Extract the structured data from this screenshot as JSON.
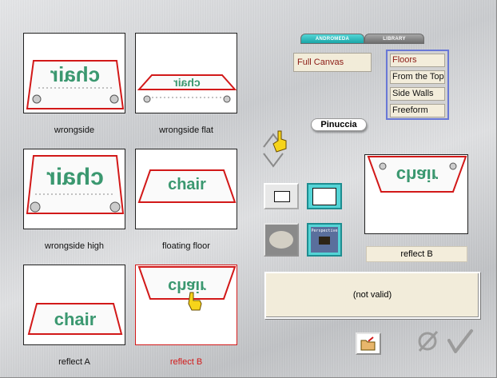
{
  "tabs": [
    {
      "label": "ANDROMEDA",
      "active": true
    },
    {
      "label": "LIBRARY",
      "active": false
    }
  ],
  "canvas_option": "Full Canvas",
  "menu_items": [
    {
      "label": "Floors",
      "selected": true
    },
    {
      "label": "From the Top",
      "selected": false
    },
    {
      "label": "Side Walls",
      "selected": false
    },
    {
      "label": "Freeform",
      "selected": false
    }
  ],
  "badge": "Pinuccia",
  "thumbnails": [
    {
      "label": "wrongside",
      "selected": false
    },
    {
      "label": "wrongside flat",
      "selected": false
    },
    {
      "label": "wrongside high",
      "selected": false
    },
    {
      "label": "floating floor",
      "selected": false
    },
    {
      "label": "reflect A",
      "selected": false
    },
    {
      "label": "reflect B",
      "selected": true
    }
  ],
  "chair_text": "chair",
  "perspective_label": "Perspective",
  "preview_label": "reflect B",
  "status_text": "(not valid)",
  "colors": {
    "selected_red": "#d21919",
    "accent_teal": "#1aa6a8",
    "menu_border": "#6978d6",
    "label_bg": "#f3eddb",
    "dark_red_text": "#8b1a14"
  }
}
